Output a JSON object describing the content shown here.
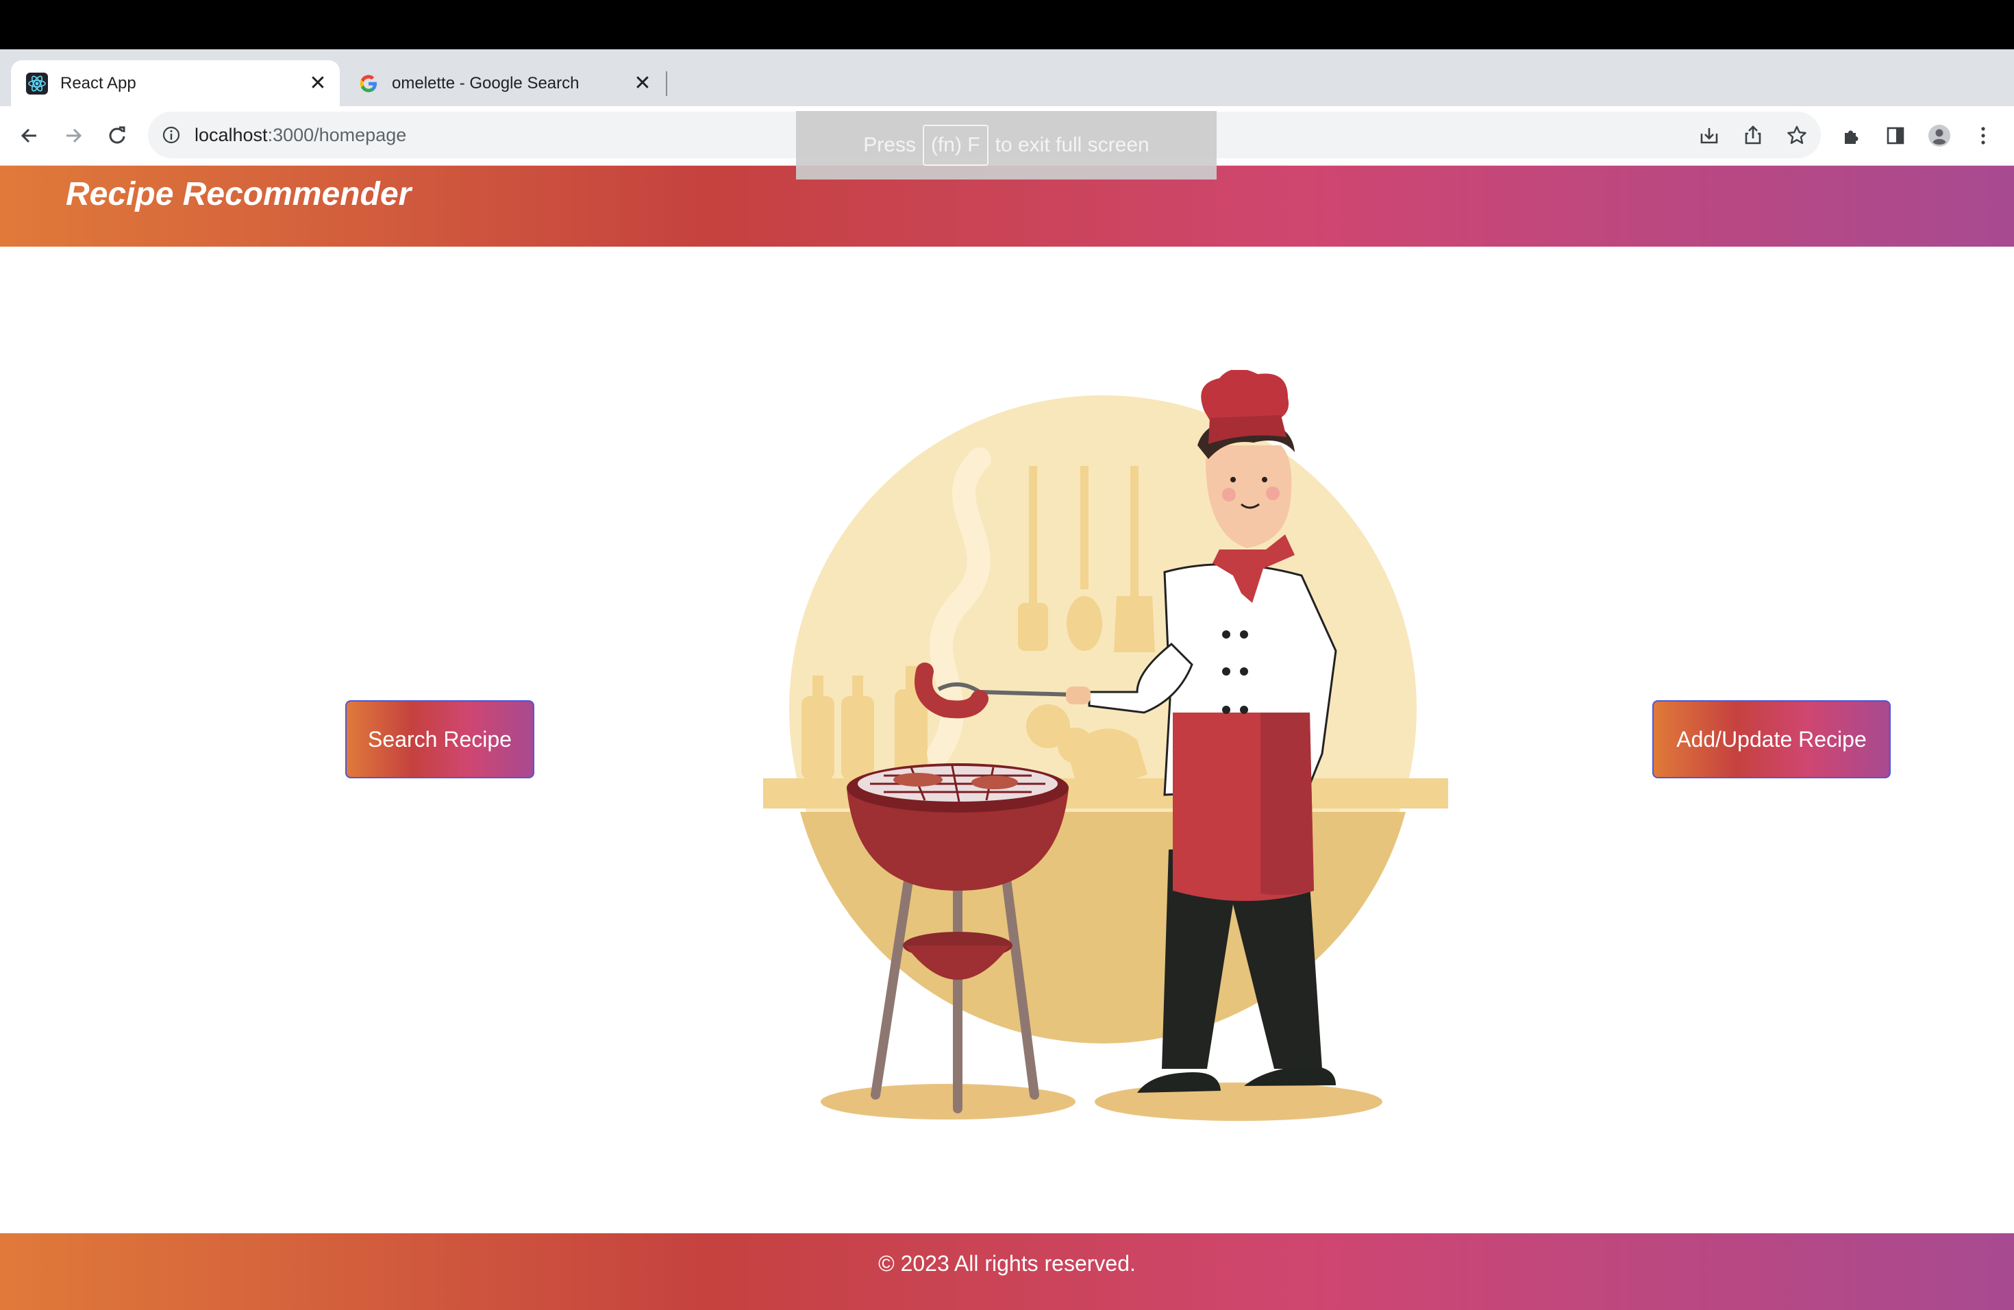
{
  "browser": {
    "tabs": [
      {
        "title": "React App",
        "favicon": "react-icon",
        "active": true
      },
      {
        "title": "omelette - Google Search",
        "favicon": "google-icon",
        "active": false
      }
    ],
    "url_host": "localhost",
    "url_path": ":3000/homepage",
    "fullscreen_toast": {
      "prefix": "Press",
      "key": "(fn) F",
      "suffix": "to exit full screen"
    }
  },
  "header": {
    "title": "Recipe Recommender"
  },
  "main": {
    "search_button": "Search Recipe",
    "add_button": "Add/Update Recipe",
    "illustration": "chef-grilling-illustration"
  },
  "footer": {
    "text": "© 2023 All rights reserved."
  },
  "colors": {
    "gradient": [
      "#e07a3a",
      "#c5423f",
      "#cf4670",
      "#a84a91"
    ],
    "button_border": "#4f56d8"
  }
}
